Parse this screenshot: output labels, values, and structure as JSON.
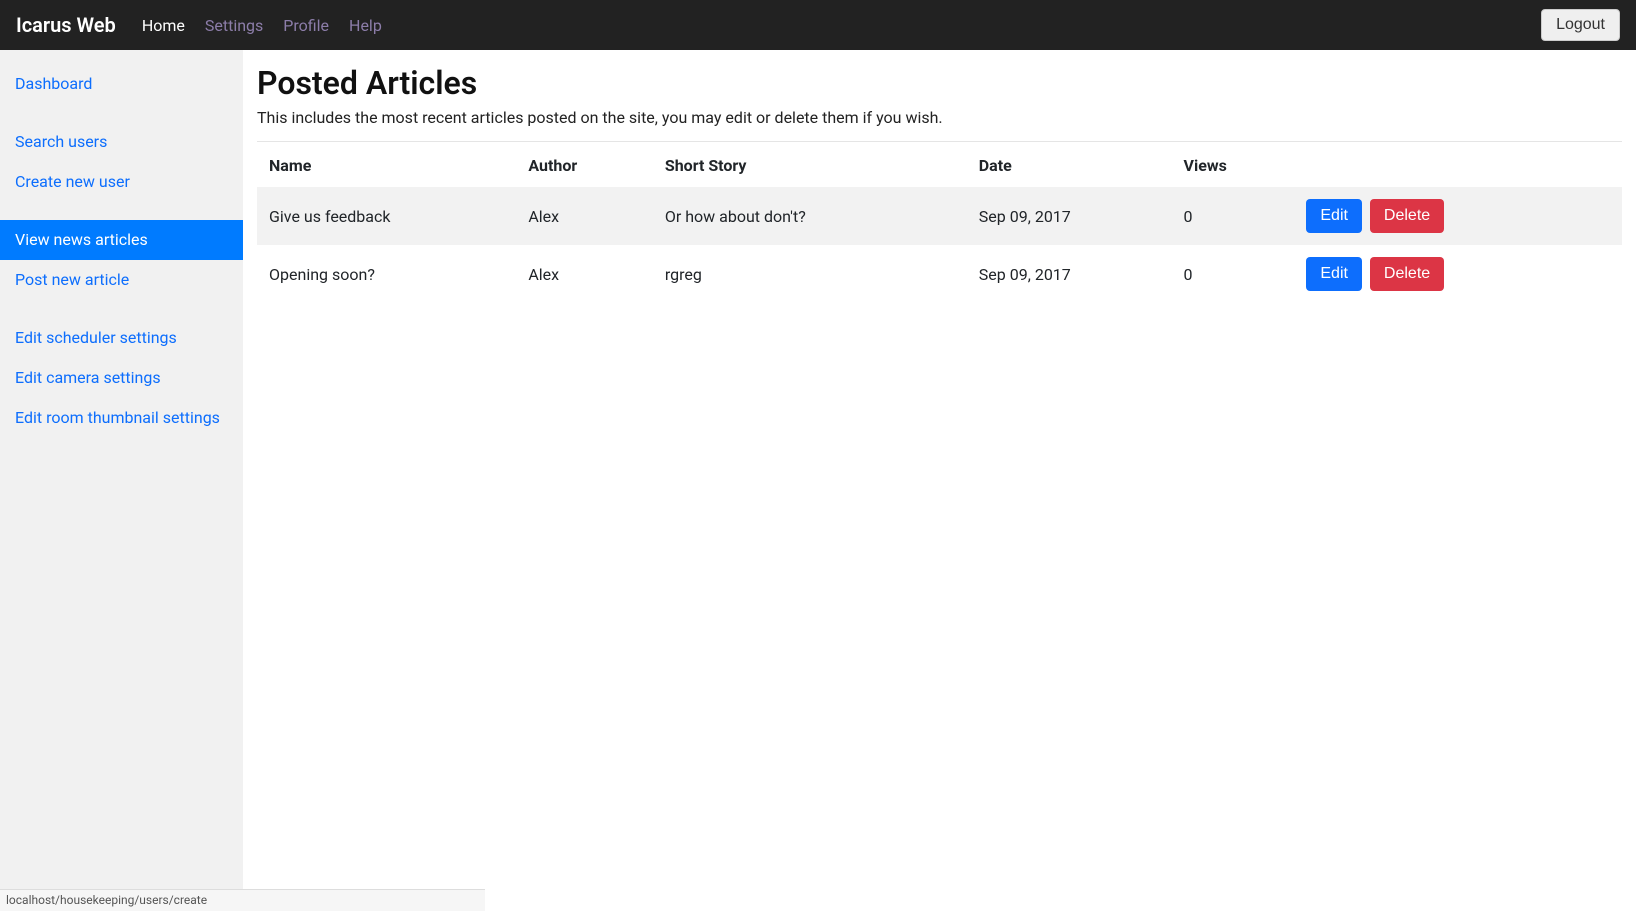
{
  "navbar": {
    "brand": "Icarus Web",
    "links": [
      {
        "label": "Home",
        "active": true
      },
      {
        "label": "Settings",
        "active": false
      },
      {
        "label": "Profile",
        "active": false
      },
      {
        "label": "Help",
        "active": false
      }
    ],
    "logout_label": "Logout"
  },
  "sidebar": {
    "groups": [
      [
        "Dashboard"
      ],
      [
        "Search users",
        "Create new user"
      ],
      [
        "View news articles",
        "Post new article"
      ],
      [
        "Edit scheduler settings",
        "Edit camera settings",
        "Edit room thumbnail settings"
      ]
    ],
    "active_item": "View news articles"
  },
  "main": {
    "title": "Posted Articles",
    "subtitle": "This includes the most recent articles posted on the site, you may edit or delete them if you wish.",
    "columns": [
      "Name",
      "Author",
      "Short Story",
      "Date",
      "Views",
      ""
    ],
    "rows": [
      {
        "name": "Give us feedback",
        "author": "Alex",
        "short_story": "Or how about don't?",
        "date": "Sep 09, 2017",
        "views": "0"
      },
      {
        "name": "Opening soon?",
        "author": "Alex",
        "short_story": "rgreg",
        "date": "Sep 09, 2017",
        "views": "0"
      }
    ],
    "edit_label": "Edit",
    "delete_label": "Delete"
  },
  "statusbar": {
    "text": "localhost/housekeeping/users/create"
  }
}
